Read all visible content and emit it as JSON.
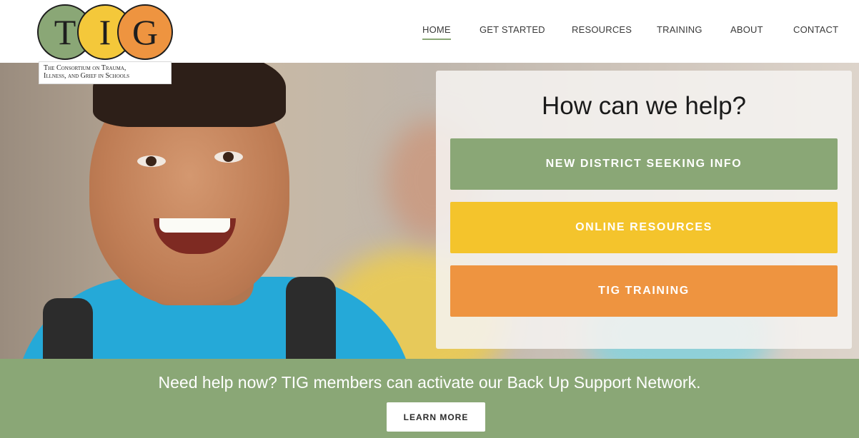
{
  "logo": {
    "letters": [
      "T",
      "I",
      "G"
    ],
    "tagline_line1": "The Consortium on Trauma,",
    "tagline_line2": "Illness, and Grief in Schools",
    "colors": [
      "#8aa776",
      "#f4c83a",
      "#ee9440"
    ]
  },
  "nav": {
    "items": [
      {
        "label": "HOME",
        "active": true
      },
      {
        "label": "GET STARTED",
        "active": false
      },
      {
        "label": "RESOURCES",
        "active": false
      },
      {
        "label": "TRAINING",
        "active": false
      },
      {
        "label": "ABOUT",
        "active": false
      },
      {
        "label": "CONTACT",
        "active": false
      }
    ]
  },
  "help": {
    "title": "How can we help?",
    "buttons": [
      {
        "label": "NEW DISTRICT SEEKING INFO",
        "color": "#8aa776"
      },
      {
        "label": "ONLINE RESOURCES",
        "color": "#f4c42c"
      },
      {
        "label": "TIG TRAINING",
        "color": "#ee9440"
      }
    ]
  },
  "support": {
    "text": "Need help now?  TIG members can activate our Back Up Support Network.",
    "button": "LEARN MORE"
  }
}
